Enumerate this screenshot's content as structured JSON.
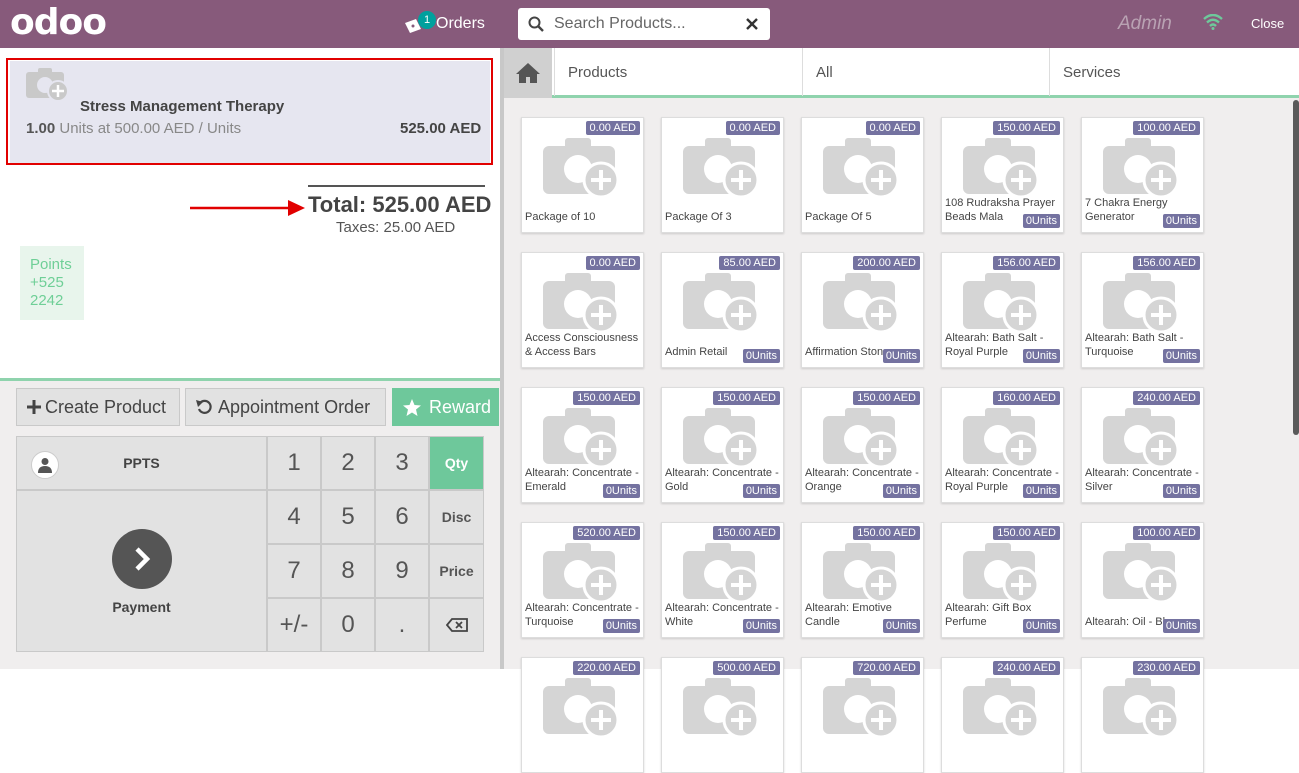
{
  "header": {
    "logo": "odoo",
    "orders_label": "Orders",
    "orders_count": "1",
    "search_placeholder": "Search Products...",
    "user": "Admin",
    "close_label": "Close"
  },
  "order": {
    "line": {
      "name": "Stress Management Therapy",
      "qty": "1.00",
      "qty_detail": "Units at 500.00 AED / Units",
      "price": "525.00 AED"
    },
    "total": "Total: 525.00 AED",
    "taxes": "Taxes: 25.00 AED",
    "points": [
      "Points",
      "+525",
      "2242"
    ]
  },
  "actions": {
    "create_product": "Create Product",
    "appointment_order": "Appointment Order",
    "reward": "Reward"
  },
  "numpad": {
    "customer": "PPTS",
    "payment": "Payment",
    "keys": [
      "1",
      "2",
      "3",
      "4",
      "5",
      "6",
      "7",
      "8",
      "9",
      "+/-",
      "0",
      "."
    ],
    "modes": [
      "Qty",
      "Disc",
      "Price"
    ],
    "active_mode": "Qty"
  },
  "categories": [
    "Products",
    "All",
    "Services"
  ],
  "products": [
    {
      "name": "Package of 10",
      "price": "0.00 AED",
      "stock": ""
    },
    {
      "name": "Package Of 3",
      "price": "0.00 AED",
      "stock": ""
    },
    {
      "name": "Package Of 5",
      "price": "0.00 AED",
      "stock": ""
    },
    {
      "name": "108 Rudraksha Prayer Beads Mala",
      "price": "150.00 AED",
      "stock": "0Units"
    },
    {
      "name": "7 Chakra Energy Generator",
      "price": "100.00 AED",
      "stock": "0Units"
    },
    {
      "name": "Access Consciousness & Access Bars",
      "price": "0.00 AED",
      "stock": ""
    },
    {
      "name": "Admin Retail",
      "price": "85.00 AED",
      "stock": "0Units"
    },
    {
      "name": "Affirmation Stones",
      "price": "200.00 AED",
      "stock": "0Units"
    },
    {
      "name": "Altearah: Bath Salt - Royal Purple",
      "price": "156.00 AED",
      "stock": "0Units"
    },
    {
      "name": "Altearah: Bath Salt - Turquoise",
      "price": "156.00 AED",
      "stock": "0Units"
    },
    {
      "name": "Altearah: Concentrate - Emerald",
      "price": "150.00 AED",
      "stock": "0Units"
    },
    {
      "name": "Altearah: Concentrate - Gold",
      "price": "150.00 AED",
      "stock": "0Units"
    },
    {
      "name": "Altearah: Concentrate - Orange",
      "price": "150.00 AED",
      "stock": "0Units"
    },
    {
      "name": "Altearah: Concentrate - Royal Purple",
      "price": "160.00 AED",
      "stock": "0Units"
    },
    {
      "name": "Altearah: Concentrate - Silver",
      "price": "240.00 AED",
      "stock": "0Units"
    },
    {
      "name": "Altearah: Concentrate - Turquoise",
      "price": "520.00 AED",
      "stock": "0Units"
    },
    {
      "name": "Altearah: Concentrate - White",
      "price": "150.00 AED",
      "stock": "0Units"
    },
    {
      "name": "Altearah: Emotive Candle",
      "price": "150.00 AED",
      "stock": "0Units"
    },
    {
      "name": "Altearah: Gift Box Perfume",
      "price": "150.00 AED",
      "stock": "0Units"
    },
    {
      "name": "Altearah: Oil - Blue",
      "price": "100.00 AED",
      "stock": "0Units"
    },
    {
      "name": "",
      "price": "220.00 AED",
      "stock": ""
    },
    {
      "name": "",
      "price": "500.00 AED",
      "stock": ""
    },
    {
      "name": "",
      "price": "720.00 AED",
      "stock": ""
    },
    {
      "name": "",
      "price": "240.00 AED",
      "stock": ""
    },
    {
      "name": "",
      "price": "230.00 AED",
      "stock": ""
    }
  ],
  "colors": {
    "header": "#875a7b",
    "accent": "#6ec89b",
    "badge": "#7472a0",
    "highlight": "#e10000"
  }
}
